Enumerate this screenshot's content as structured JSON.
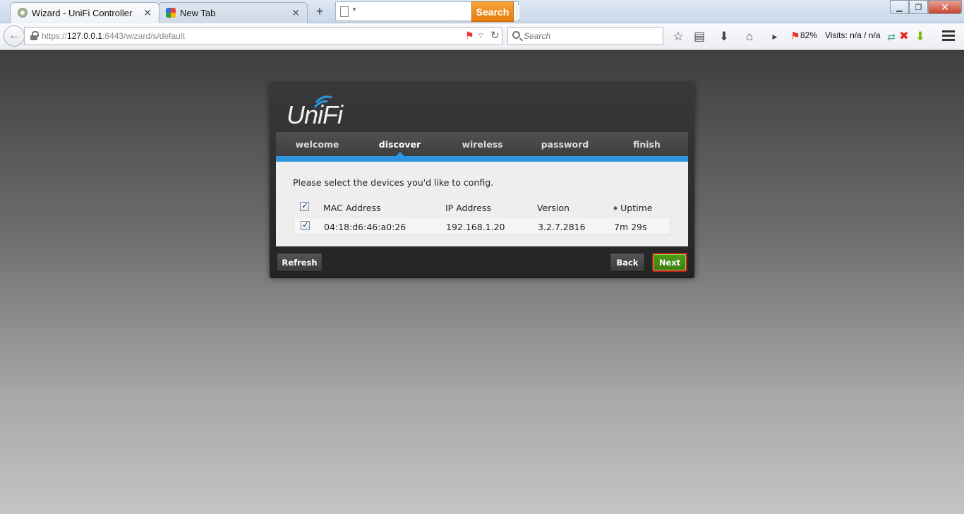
{
  "browser": {
    "tabs": [
      {
        "title": "Wizard - UniFi Controller",
        "close": "✕"
      },
      {
        "title": "New Tab",
        "close": "✕"
      }
    ],
    "new_tab": "+",
    "toolbar_search_button": "Search",
    "url": {
      "prefix": "https://",
      "host": "127.0.0.1",
      "rest": ":8443/wizard/s/default"
    },
    "search_placeholder": "Search",
    "zoom_percent": "82%",
    "visits": "Visits: n/a / n/a",
    "window_controls": {
      "minimize": "▁",
      "maximize": "❐",
      "close": "✕"
    }
  },
  "wizard": {
    "logo": "UniFi",
    "steps": [
      "welcome",
      "discover",
      "wireless",
      "password",
      "finish"
    ],
    "current_step": "discover",
    "instruction": "Please select the devices you'd like to config.",
    "columns": {
      "mac": "MAC Address",
      "ip": "IP Address",
      "version": "Version",
      "uptime": "Uptime"
    },
    "devices": [
      {
        "mac": "04:18:d6:46:a0:26",
        "ip": "192.168.1.20",
        "version": "3.2.7.2816",
        "uptime": "7m 29s",
        "checked": true
      }
    ],
    "buttons": {
      "refresh": "Refresh",
      "back": "Back",
      "next": "Next"
    },
    "colors": {
      "accent": "#2c95de",
      "next_button": "#4e9a16",
      "highlight_border": "#c21c1c"
    }
  }
}
